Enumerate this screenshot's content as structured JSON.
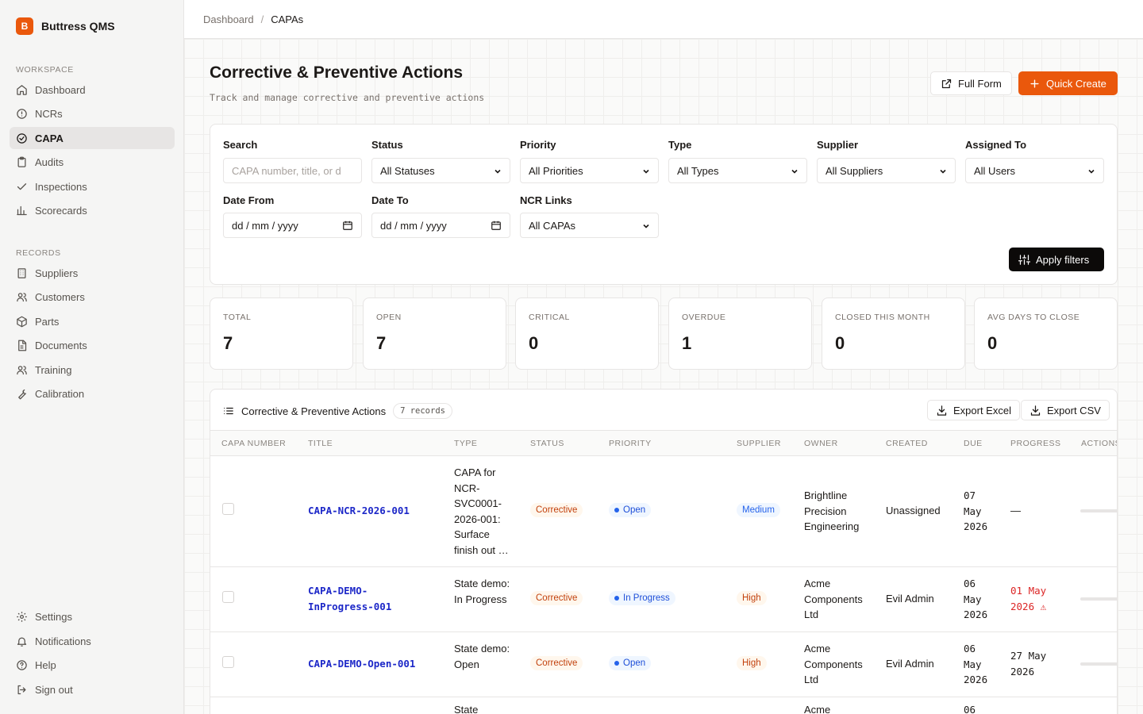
{
  "brand": {
    "logo_letter": "B",
    "name": "Buttress QMS"
  },
  "sidebar": {
    "workspace_label": "WORKSPACE",
    "workspace_items": [
      {
        "label": "Dashboard",
        "icon": "home-icon"
      },
      {
        "label": "NCRs",
        "icon": "alert-circle-icon"
      },
      {
        "label": "CAPA",
        "icon": "check-circle-icon",
        "active": true
      },
      {
        "label": "Audits",
        "icon": "clipboard-icon"
      },
      {
        "label": "Inspections",
        "icon": "check-icon"
      },
      {
        "label": "Scorecards",
        "icon": "bar-chart-icon"
      }
    ],
    "records_label": "RECORDS",
    "records_items": [
      {
        "label": "Suppliers",
        "icon": "building-icon"
      },
      {
        "label": "Customers",
        "icon": "users-icon"
      },
      {
        "label": "Parts",
        "icon": "package-icon"
      },
      {
        "label": "Documents",
        "icon": "file-icon"
      },
      {
        "label": "Training",
        "icon": "users-icon"
      },
      {
        "label": "Calibration",
        "icon": "wrench-icon"
      }
    ],
    "bottom_items": [
      {
        "label": "Settings",
        "icon": "gear-icon"
      },
      {
        "label": "Notifications",
        "icon": "bell-icon"
      },
      {
        "label": "Help",
        "icon": "help-circle-icon"
      },
      {
        "label": "Sign out",
        "icon": "logout-icon"
      }
    ]
  },
  "breadcrumb": {
    "parent": "Dashboard",
    "separator": "/",
    "current": "CAPAs"
  },
  "page": {
    "title": "Corrective & Preventive Actions",
    "subtitle": "Track and manage corrective and preventive actions",
    "full_form_label": "Full Form",
    "quick_create_label": "Quick Create"
  },
  "filters": {
    "search": {
      "label": "Search",
      "placeholder": "CAPA number, title, or d"
    },
    "status": {
      "label": "Status",
      "value": "All Statuses"
    },
    "priority": {
      "label": "Priority",
      "value": "All Priorities"
    },
    "type": {
      "label": "Type",
      "value": "All Types"
    },
    "supplier": {
      "label": "Supplier",
      "value": "All Suppliers"
    },
    "assigned_to": {
      "label": "Assigned To",
      "value": "All Users"
    },
    "date_from": {
      "label": "Date From",
      "value": "dd / mm / yyyy"
    },
    "date_to": {
      "label": "Date To",
      "value": "dd / mm / yyyy"
    },
    "ncr_links": {
      "label": "NCR Links",
      "value": "All CAPAs"
    },
    "apply_label": "Apply filters"
  },
  "stats": [
    {
      "label": "TOTAL",
      "value": "7"
    },
    {
      "label": "OPEN",
      "value": "7"
    },
    {
      "label": "CRITICAL",
      "value": "0"
    },
    {
      "label": "OVERDUE",
      "value": "1"
    },
    {
      "label": "CLOSED THIS MONTH",
      "value": "0"
    },
    {
      "label": "AVG DAYS TO CLOSE",
      "value": "0"
    }
  ],
  "table": {
    "title": "Corrective & Preventive Actions",
    "records_badge": "7 records",
    "export_excel_label": "Export Excel",
    "export_csv_label": "Export CSV",
    "columns": [
      "CAPA NUMBER",
      "TITLE",
      "TYPE",
      "STATUS",
      "PRIORITY",
      "SUPPLIER",
      "OWNER",
      "CREATED",
      "DUE",
      "PROGRESS",
      "ACTIONS"
    ],
    "rows": [
      {
        "capa_number": "CAPA-NCR-2026-001",
        "title": "CAPA for NCR-SVC0001-2026-001: Surface finish out …",
        "type": "Corrective",
        "status": "Open",
        "priority": "Medium",
        "supplier": "Brightline Precision Engineering",
        "owner": "Unassigned",
        "created": "07 May 2026",
        "due": "—"
      },
      {
        "capa_number": "CAPA-DEMO-InProgress-001",
        "title": "State demo: In Progress",
        "type": "Corrective",
        "status": "In Progress",
        "priority": "High",
        "supplier": "Acme Components Ltd",
        "owner": "Evil Admin",
        "created": "06 May 2026",
        "due": "01 May 2026 ⚠",
        "due_overdue": true
      },
      {
        "capa_number": "CAPA-DEMO-Open-001",
        "title": "State demo: Open",
        "type": "Corrective",
        "status": "Open",
        "priority": "High",
        "supplier": "Acme Components Ltd",
        "owner": "Evil Admin",
        "created": "06 May 2026",
        "due": "27 May 2026"
      },
      {
        "title": "State",
        "supplier": "Acme",
        "created": "06"
      }
    ]
  },
  "colors": {
    "accent": "#ea580c",
    "link": "#1d28c8",
    "overdue": "#dc2626"
  }
}
